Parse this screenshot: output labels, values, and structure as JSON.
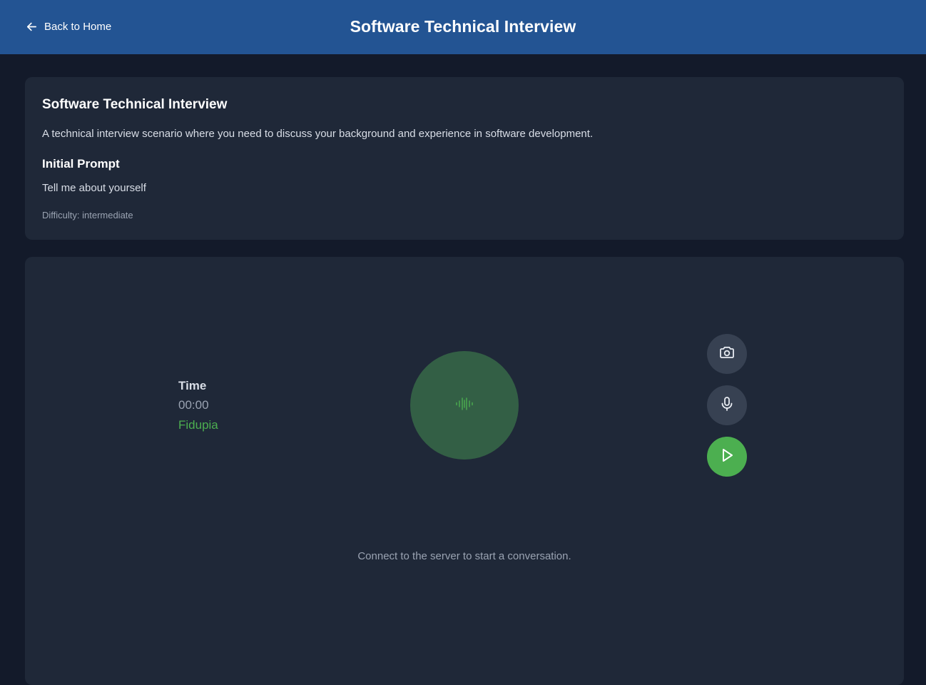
{
  "header": {
    "back_label": "Back to Home",
    "title": "Software Technical Interview"
  },
  "scenario": {
    "title": "Software Technical Interview",
    "description": "A technical interview scenario where you need to discuss your background and experience in software development.",
    "prompt_heading": "Initial Prompt",
    "prompt_text": "Tell me about yourself",
    "difficulty": "Difficulty: intermediate"
  },
  "session": {
    "timer_label": "Time",
    "timer_value": "00:00",
    "agent_name": "Fidupia",
    "status_message": "Connect to the server to start a conversation."
  },
  "controls": [
    {
      "name": "camera-icon"
    },
    {
      "name": "microphone-icon"
    },
    {
      "name": "play-icon"
    }
  ],
  "colors": {
    "header_bg": "#235493",
    "page_bg": "#131a2a",
    "card_bg": "#1f2838",
    "accent_green": "#4caf50",
    "visualizer_bg": "#335f45",
    "control_bg": "#374152"
  }
}
